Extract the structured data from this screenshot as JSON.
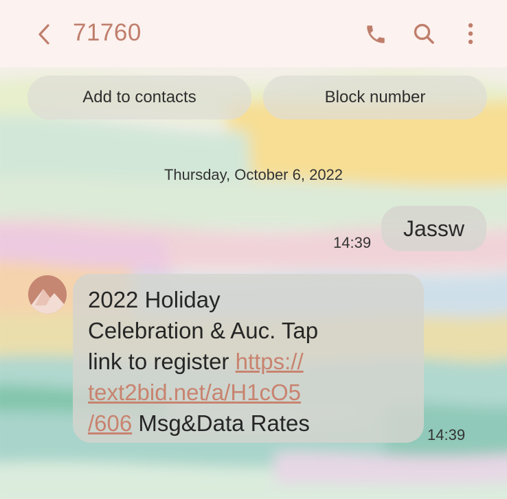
{
  "header": {
    "title": "71760",
    "icons": [
      "back-icon",
      "phone-icon",
      "search-icon",
      "more-vert-icon"
    ]
  },
  "actions": {
    "add_contact_label": "Add to contacts",
    "block_number_label": "Block number"
  },
  "conversation": {
    "date_separator": "Thursday, October 6, 2022",
    "outgoing": {
      "text": "Jassw",
      "time": "14:39"
    },
    "incoming": {
      "line1": "2022 Holiday",
      "line2": "Celebration & Auc. Tap",
      "line3_text": "link to register ",
      "line3_link": "https://",
      "line4_link": "text2bid.net/a/H1cO5",
      "line5_link": "/606",
      "line5_text": " Msg&Data Rates",
      "time": "14:39"
    }
  },
  "colors": {
    "accent": "#bf7e6c",
    "header_bg": "#fcf2ef",
    "bubble_bg": "#d5d5cf"
  }
}
